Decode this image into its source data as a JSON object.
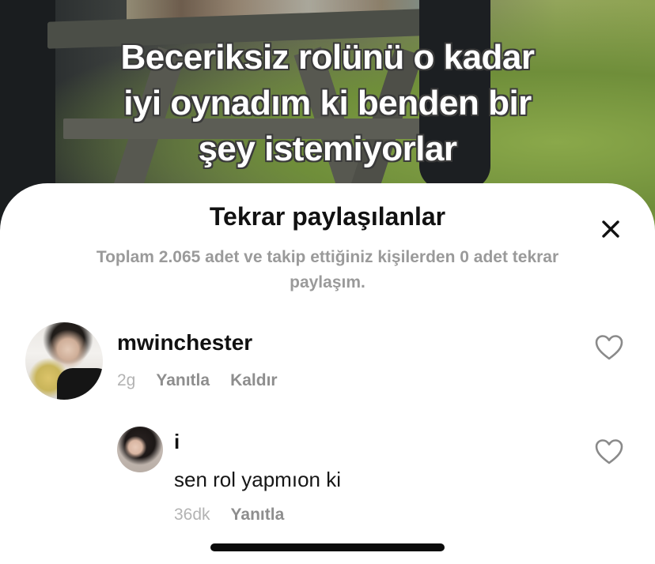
{
  "video": {
    "caption_lines": [
      "Beceriksiz rolünü o kadar",
      "iyi oynadım ki benden bir",
      "şey istemiyorlar"
    ]
  },
  "sheet": {
    "title": "Tekrar paylaşılanlar",
    "subtitle": "Toplam 2.065 adet ve takip ettiğiniz kişilerden 0 adet tekrar paylaşım.",
    "close_icon": "close-icon"
  },
  "comments": [
    {
      "username": "mwinchester",
      "time": "2g",
      "reply_label": "Yanıtla",
      "remove_label": "Kaldır",
      "like_icon": "heart-outline-icon"
    },
    {
      "username": "i",
      "text": "sen rol yapmıon ki",
      "time": "36dk",
      "reply_label": "Yanıtla",
      "like_icon": "heart-outline-icon"
    }
  ],
  "colors": {
    "sheet_bg": "#ffffff",
    "muted_text": "#9a9a9a",
    "primary_text": "#111111"
  }
}
